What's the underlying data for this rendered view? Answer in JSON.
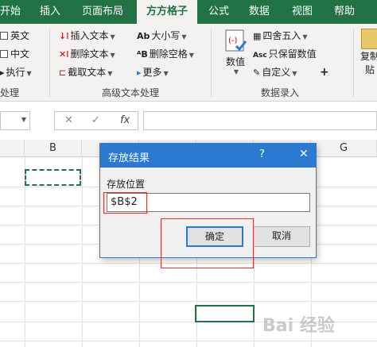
{
  "tabs": [
    "开始",
    "插入",
    "页面布局",
    "方方格子",
    "公式",
    "数据",
    "视图",
    "帮助"
  ],
  "active_tab": "方方格子",
  "ribbon": {
    "group1": {
      "items": [
        "英文",
        "中文",
        "执行"
      ],
      "label": "处理"
    },
    "group2": {
      "col1": [
        "插入文本",
        "删除文本",
        "截取文本"
      ],
      "col2": [
        "大小写",
        "删除空格",
        "更多"
      ],
      "label": "高级文本处理"
    },
    "group3": {
      "big_button": "数值",
      "items": [
        "四舍五入",
        "只保留数值",
        "自定义"
      ],
      "plus": "+",
      "label": "数据录入"
    },
    "group4": {
      "big_button_line1": "复制",
      "big_button_line2": "贴"
    }
  },
  "formula_bar": {
    "cancel": "✕",
    "confirm": "✓",
    "fx": "fx"
  },
  "columns": [
    "B",
    "",
    "",
    "",
    "",
    "G"
  ],
  "dialog": {
    "title": "存放结果",
    "help": "?",
    "close": "✕",
    "label": "存放位置",
    "value": "$B$2",
    "ok": "确定",
    "cancel": "取消"
  },
  "watermark": "Bai 经验",
  "colors": {
    "excel_green": "#217346",
    "dialog_blue": "#2b79d0",
    "highlight_red": "#e03030"
  }
}
